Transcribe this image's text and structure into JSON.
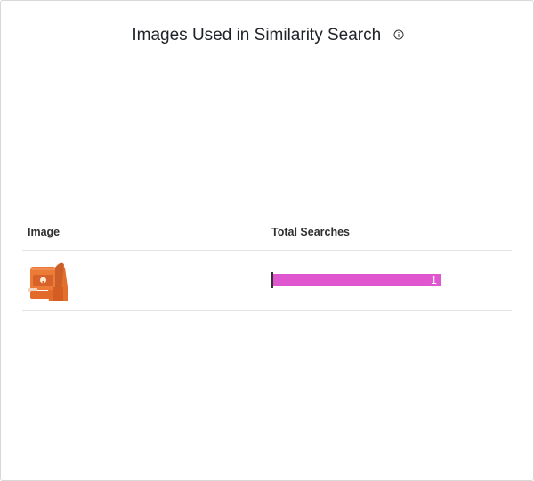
{
  "panel": {
    "title": "Images Used in Similarity Search",
    "title_icon": "info-icon"
  },
  "table": {
    "columns": [
      "Image",
      "Total Searches"
    ],
    "rows": [
      {
        "image": "orange-backpack-thumbnail",
        "total_searches": 1
      }
    ]
  },
  "chart_data": {
    "type": "bar",
    "categories": [
      "orange-backpack-thumbnail"
    ],
    "values": [
      1
    ],
    "title": "Images Used in Similarity Search",
    "xlabel": "Total Searches",
    "ylabel": "Image",
    "orientation": "horizontal",
    "bar_color": "#e056cf"
  },
  "colors": {
    "bar": "#e056cf",
    "divider": "#e3e3e3",
    "text": "#1f2328"
  }
}
